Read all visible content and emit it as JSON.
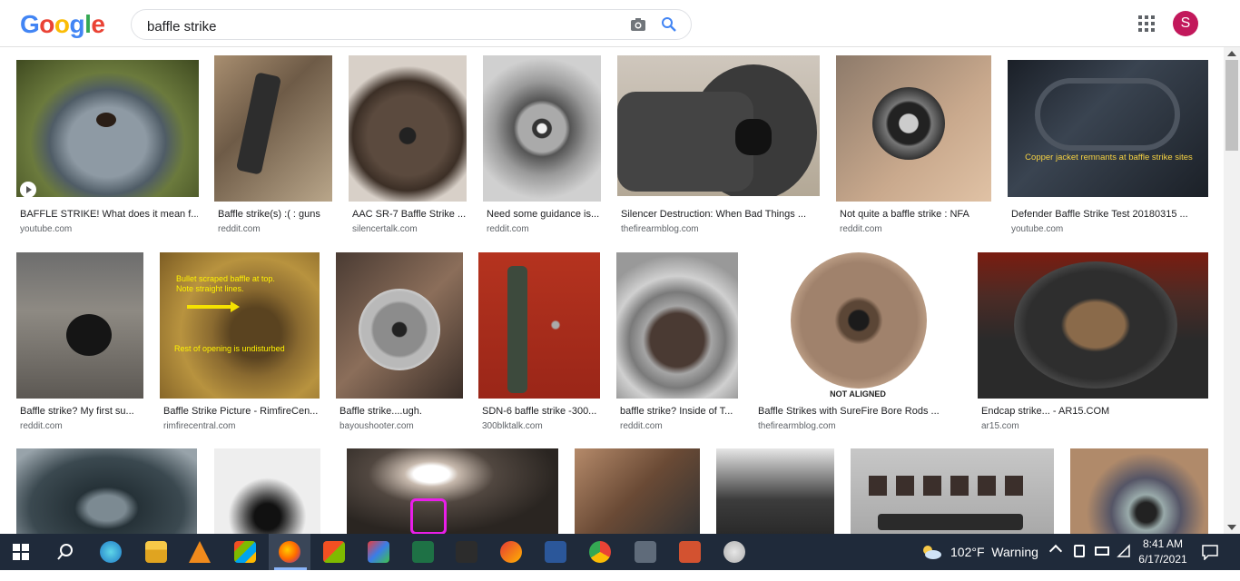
{
  "header": {
    "logo_letters": [
      "G",
      "o",
      "o",
      "g",
      "l",
      "e"
    ],
    "query": "baffle strike",
    "avatar_letter": "S"
  },
  "results": [
    {
      "caption": "BAFFLE STRIKE! What does it mean f...",
      "source": "youtube.com",
      "has_video": true
    },
    {
      "caption": "Baffle strike(s) :( : guns",
      "source": "reddit.com"
    },
    {
      "caption": "AAC SR-7 Baffle Strike ...",
      "source": "silencertalk.com"
    },
    {
      "caption": "Need some guidance is...",
      "source": "reddit.com"
    },
    {
      "caption": "Silencer Destruction: When Bad Things ...",
      "source": "thefirearmblog.com"
    },
    {
      "caption": "Not quite a baffle strike : NFA",
      "source": "reddit.com"
    },
    {
      "caption": "Defender Baffle Strike Test 20180315 ...",
      "source": "youtube.com",
      "overlay": "Copper jacket remnants at baffle strike sites"
    },
    {
      "caption": "Baffle strike? My first su...",
      "source": "reddit.com"
    },
    {
      "caption": "Baffle Strike Picture - RimfireCen...",
      "source": "rimfirecentral.com",
      "overlay_top": "Bullet scraped baffle at top. Note straight lines.",
      "overlay_bottom": "Rest of opening is undisturbed"
    },
    {
      "caption": "Baffle strike....ugh.",
      "source": "bayoushooter.com"
    },
    {
      "caption": "SDN-6 baffle strike -300...",
      "source": "300blktalk.com"
    },
    {
      "caption": "baffle strike? Inside of T...",
      "source": "reddit.com"
    },
    {
      "caption": "Baffle Strikes with SureFire Bore Rods ...",
      "source": "thefirearmblog.com",
      "overlay": "NOT ALIGNED"
    },
    {
      "caption": "Endcap strike... - AR15.COM",
      "source": "ar15.com"
    },
    {
      "caption": "",
      "source": ""
    },
    {
      "caption": "",
      "source": ""
    },
    {
      "caption": "",
      "source": ""
    },
    {
      "caption": "",
      "source": ""
    },
    {
      "caption": "",
      "source": ""
    },
    {
      "caption": "",
      "source": ""
    },
    {
      "caption": "",
      "source": ""
    }
  ],
  "taskbar": {
    "weather": "102°F  Warning",
    "time": "8:41 AM",
    "date": "6/17/2021"
  }
}
